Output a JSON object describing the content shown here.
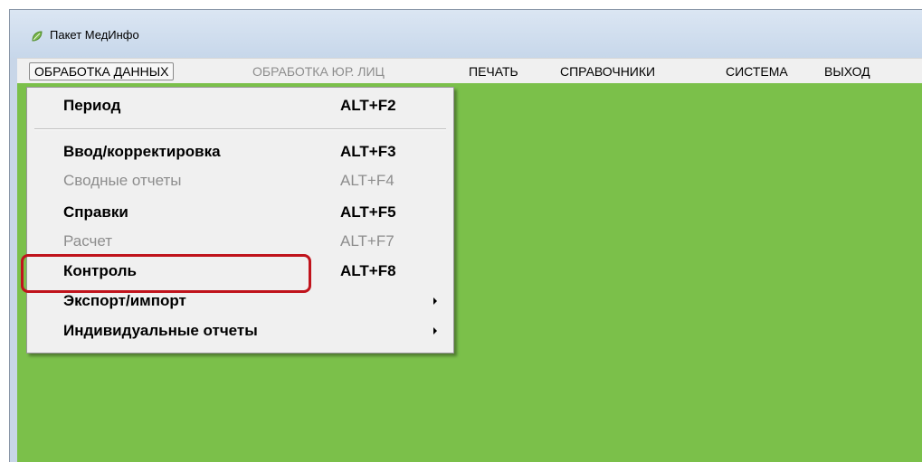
{
  "window": {
    "title": "Пакет МедИнфо",
    "icon": "leaf-app-icon"
  },
  "menubar": {
    "items": [
      {
        "label": "ОБРАБОТКА ДАННЫХ",
        "state": "active"
      },
      {
        "label": "ОБРАБОТКА ЮР. ЛИЦ",
        "state": "disabled"
      },
      {
        "label": "ПЕЧАТЬ",
        "state": "normal"
      },
      {
        "label": "СПРАВОЧНИКИ",
        "state": "normal"
      },
      {
        "label": "СИСТЕМА",
        "state": "normal"
      },
      {
        "label": "ВЫХОД",
        "state": "normal"
      }
    ]
  },
  "dropdown": {
    "items": [
      {
        "label": "Период",
        "shortcut": "ALT+F2",
        "enabled": true
      },
      {
        "label": "Ввод/корректировка",
        "shortcut": "ALT+F3",
        "enabled": true
      },
      {
        "label": "Сводные отчеты",
        "shortcut": "ALT+F4",
        "enabled": false
      },
      {
        "label": "Справки",
        "shortcut": "ALT+F5",
        "enabled": true
      },
      {
        "label": "Расчет",
        "shortcut": "ALT+F7",
        "enabled": false
      },
      {
        "label": "Контроль",
        "shortcut": "ALT+F8",
        "enabled": true,
        "annotated": true
      },
      {
        "label": "Экспорт/импорт",
        "submenu": true,
        "enabled": true
      },
      {
        "label": "Индивидуальные отчеты",
        "submenu": true,
        "enabled": true
      }
    ]
  },
  "colors": {
    "client_background": "#7bc04a",
    "highlight": "#c0131c",
    "menu_background": "#f0f0f0",
    "disabled_text": "#8d8d8d"
  }
}
